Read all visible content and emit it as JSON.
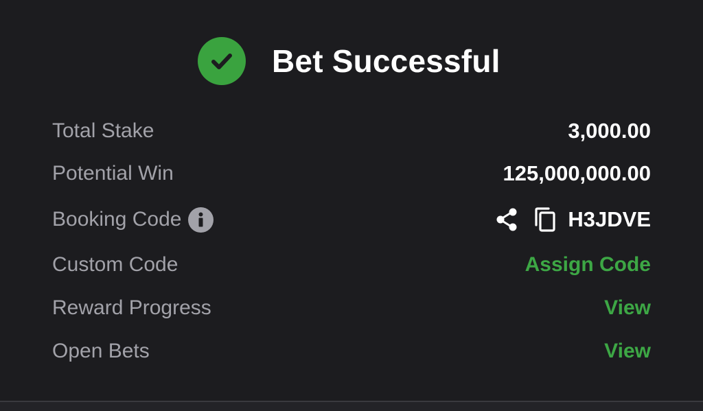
{
  "header": {
    "title": "Bet Successful",
    "icon": "check-circle-icon"
  },
  "rows": {
    "total_stake": {
      "label": "Total Stake",
      "value": "3,000.00"
    },
    "potential_win": {
      "label": "Potential Win",
      "value": "125,000,000.00"
    },
    "booking_code": {
      "label": "Booking Code",
      "value": "H3JDVE",
      "icons": [
        "info-icon",
        "share-icon",
        "copy-icon"
      ]
    },
    "custom_code": {
      "label": "Custom Code",
      "action": "Assign Code"
    },
    "reward_progress": {
      "label": "Reward Progress",
      "action": "View"
    },
    "open_bets": {
      "label": "Open Bets",
      "action": "View"
    }
  },
  "colors": {
    "background": "#1c1c1f",
    "success_green": "#3aa33f",
    "link_green": "#3da745",
    "label_grey": "#a2a2a9",
    "value_white": "#ffffff"
  }
}
